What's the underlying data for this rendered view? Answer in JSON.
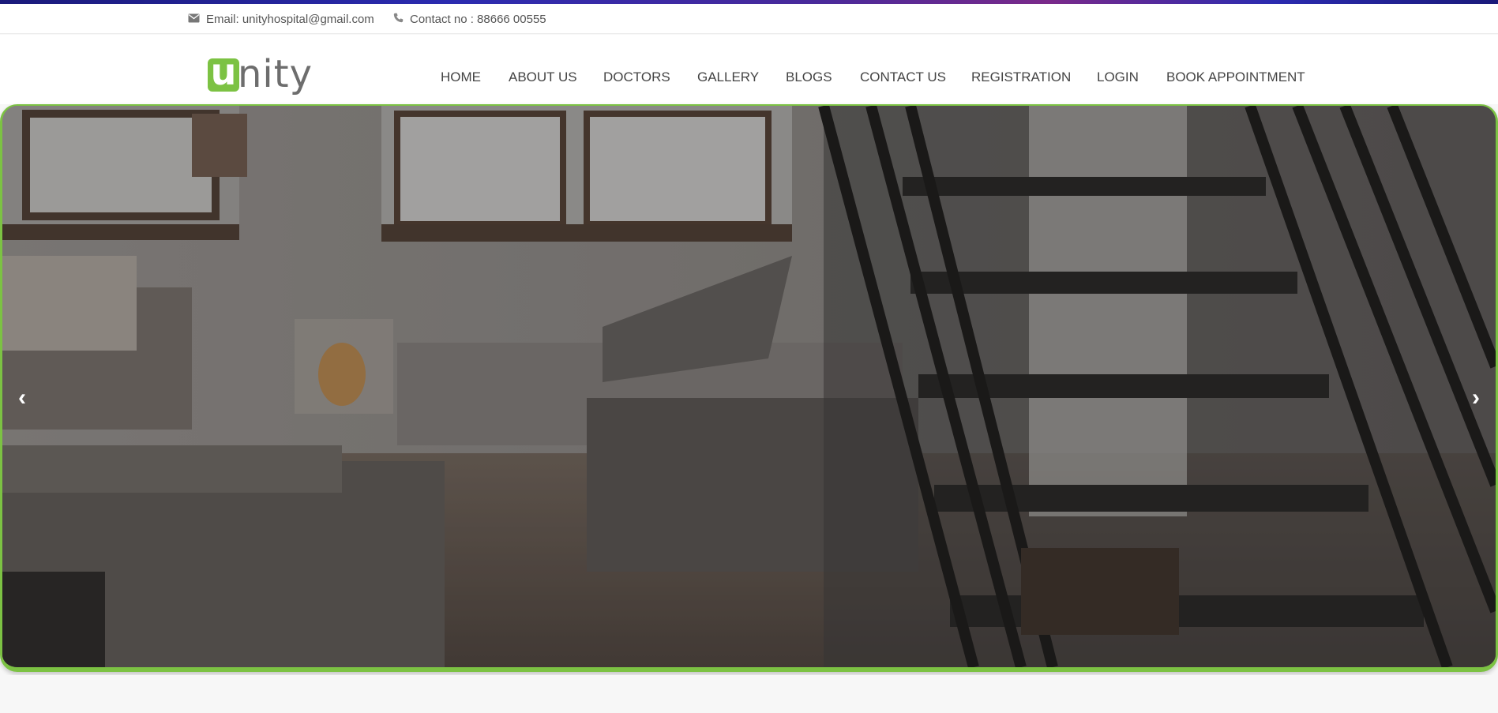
{
  "contact": {
    "email_text": "Email: unityhospital@gmail.com",
    "phone_text": "Contact no : 88666 00555"
  },
  "logo": {
    "letter": "u",
    "rest": "nity"
  },
  "nav": {
    "items": [
      {
        "label": "HOME"
      },
      {
        "label": "ABOUT US"
      },
      {
        "label": "DOCTORS"
      },
      {
        "label": "GALLERY"
      },
      {
        "label": "BLOGS"
      },
      {
        "label": "CONTACT US"
      },
      {
        "label": "REGISTRATION"
      },
      {
        "label": "LOGIN"
      },
      {
        "label": "BOOK APPOINTMENT"
      }
    ]
  },
  "slider": {
    "prev_label": "‹",
    "next_label": "›"
  },
  "colors": {
    "accent": "#7cc243",
    "nav_text": "#444444",
    "top_strip": "#2b2bb0"
  }
}
